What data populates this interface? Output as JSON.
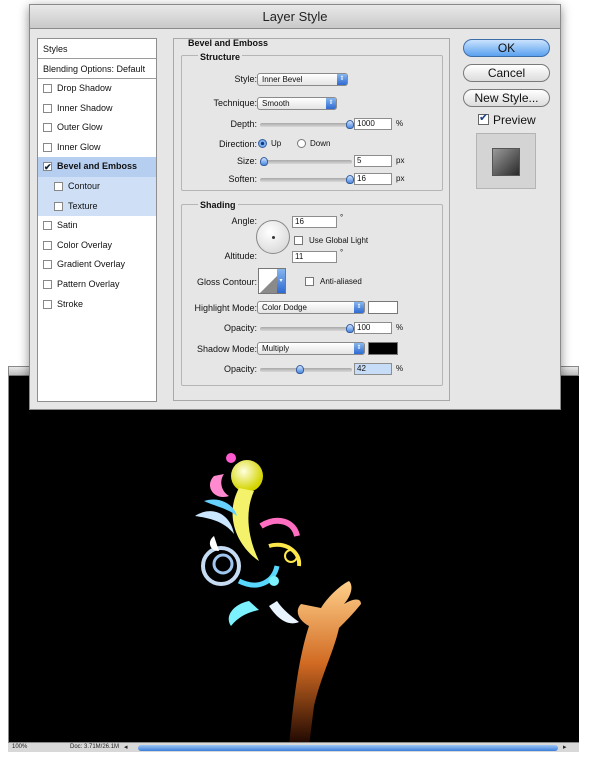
{
  "dialog": {
    "title": "Layer Style"
  },
  "styles_panel": {
    "header": "Styles",
    "blending": "Blending Options: Default",
    "items": [
      {
        "label": "Drop Shadow"
      },
      {
        "label": "Inner Shadow"
      },
      {
        "label": "Outer Glow"
      },
      {
        "label": "Inner Glow"
      },
      {
        "label": "Bevel and Emboss"
      },
      {
        "label": "Contour"
      },
      {
        "label": "Texture"
      },
      {
        "label": "Satin"
      },
      {
        "label": "Color Overlay"
      },
      {
        "label": "Gradient Overlay"
      },
      {
        "label": "Pattern Overlay"
      },
      {
        "label": "Stroke"
      }
    ]
  },
  "buttons": {
    "ok": "OK",
    "cancel": "Cancel",
    "new_style": "New Style...",
    "preview": "Preview"
  },
  "bevel": {
    "title": "Bevel and Emboss",
    "structure": {
      "title": "Structure",
      "style_label": "Style:",
      "style_value": "Inner Bevel",
      "technique_label": "Technique:",
      "technique_value": "Smooth",
      "depth_label": "Depth:",
      "depth_value": "1000",
      "depth_unit": "%",
      "direction_label": "Direction:",
      "dir_up": "Up",
      "dir_down": "Down",
      "size_label": "Size:",
      "size_value": "5",
      "size_unit": "px",
      "soften_label": "Soften:",
      "soften_value": "16",
      "soften_unit": "px"
    },
    "shading": {
      "title": "Shading",
      "angle_label": "Angle:",
      "angle_value": "16",
      "degree": "°",
      "global_light": "Use Global Light",
      "altitude_label": "Altitude:",
      "altitude_value": "11",
      "gloss_label": "Gloss Contour:",
      "anti_aliased": "Anti-aliased",
      "highlight_label": "Highlight Mode:",
      "highlight_value": "Color Dodge",
      "highlight_color": "#ffffff",
      "hl_opacity_label": "Opacity:",
      "hl_opacity_value": "100",
      "hl_opacity_unit": "%",
      "shadow_label": "Shadow Mode:",
      "shadow_value": "Multiply",
      "shadow_color": "#000000",
      "sh_opacity_label": "Opacity:",
      "sh_opacity_value": "42",
      "sh_opacity_unit": "%"
    }
  },
  "status": {
    "zoom": "100%",
    "doc": "Doc: 3.71M/26.1M"
  }
}
